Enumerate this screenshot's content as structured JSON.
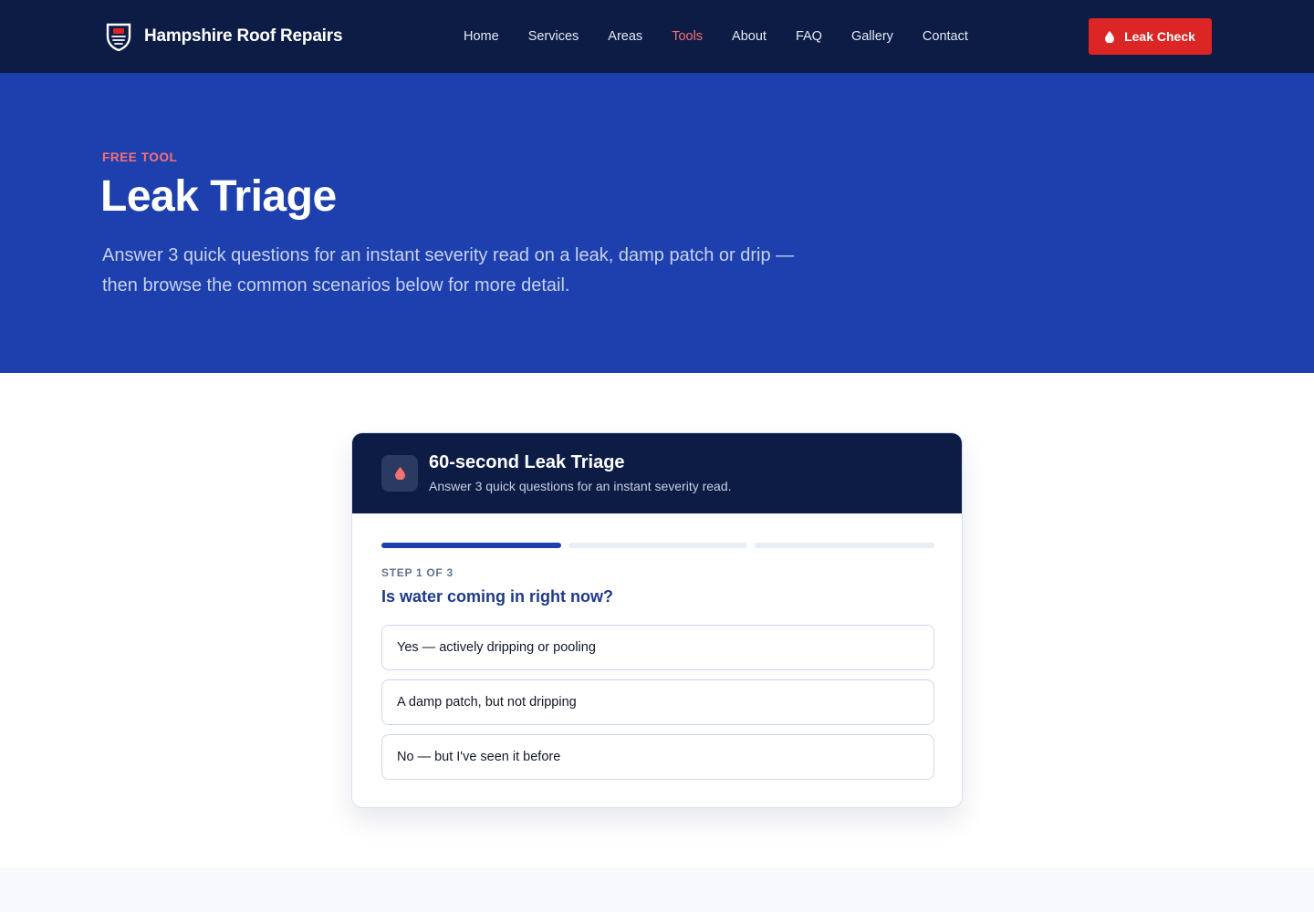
{
  "brand": {
    "name": "Hampshire Roof Repairs",
    "logo_icon": "shield-logo-icon"
  },
  "nav": {
    "links": [
      {
        "label": "Home",
        "active": false
      },
      {
        "label": "Services",
        "active": false
      },
      {
        "label": "Areas",
        "active": false
      },
      {
        "label": "Tools",
        "active": true
      },
      {
        "label": "About",
        "active": false
      },
      {
        "label": "FAQ",
        "active": false
      },
      {
        "label": "Gallery",
        "active": false
      },
      {
        "label": "Contact",
        "active": false
      }
    ],
    "cta": {
      "label": "Leak Check",
      "icon": "water-drop-icon"
    }
  },
  "hero": {
    "eyebrow": "FREE TOOL",
    "title": "Leak Triage",
    "subtitle": "Answer 3 quick questions for an instant severity read on a leak, damp patch or drip — then browse the common scenarios below for more detail."
  },
  "triage": {
    "icon": "water-drop-icon",
    "title": "60-second Leak Triage",
    "subtitle": "Answer 3 quick questions for an instant severity read.",
    "progress": {
      "current_step": 1,
      "total_steps": 3
    },
    "step_label": "STEP 1 OF 3",
    "question": "Is water coming in right now?",
    "options": [
      "Yes — actively dripping or pooling",
      "A damp patch, but not dripping",
      "No — but I've seen it before"
    ]
  },
  "colors": {
    "nav_bg": "#0c1c45",
    "hero_bg": "#1e40af",
    "accent_red": "#dc2626",
    "eyebrow_red": "#f87171",
    "question_blue": "#1e3a8a"
  }
}
